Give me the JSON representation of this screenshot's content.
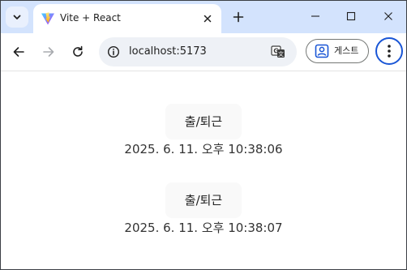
{
  "browser": {
    "tab": {
      "title": "Vite + React"
    },
    "omnibox": {
      "url": "localhost:5173"
    },
    "profile": {
      "label": "게스트"
    }
  },
  "page": {
    "entries": [
      {
        "button_label": "출/퇴근",
        "timestamp": "2025. 6. 11. 오후 10:38:06"
      },
      {
        "button_label": "출/퇴근",
        "timestamp": "2025. 6. 11. 오후 10:38:07"
      }
    ]
  },
  "colors": {
    "tabstrip": "#d3e3fd",
    "omnibox": "#eef1f6",
    "menu_ring": "#1a56d6",
    "button_bg": "#f9f9f9"
  },
  "icons": {
    "tab_search": "chevron-down-icon",
    "favicon": "vite-logo-icon",
    "tab_close": "close-icon",
    "new_tab": "plus-icon",
    "back": "arrow-left-icon",
    "forward": "arrow-right-icon",
    "reload": "reload-icon",
    "site_info": "info-icon",
    "translate": "translate-icon",
    "profile": "person-badge-icon",
    "menu": "kebab-menu-icon"
  }
}
